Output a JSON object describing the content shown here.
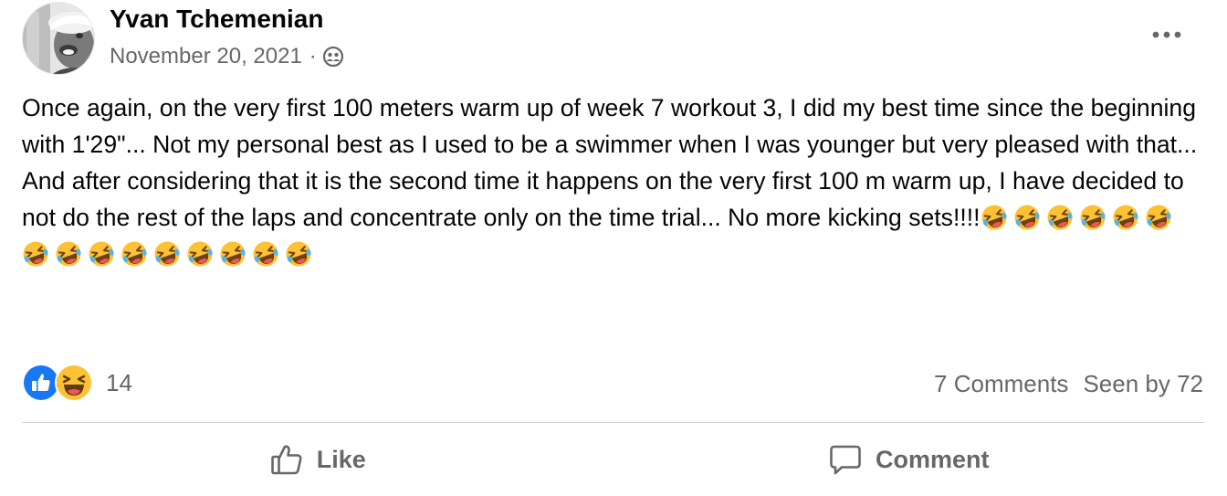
{
  "post": {
    "author": "Yvan Tchemenian",
    "date": "November 20, 2021",
    "separator": "·",
    "audience_icon": "group-icon",
    "more_icon": "more-options-icon",
    "text": "Once again, on the very first 100 meters warm up of week 7 workout 3, I did my best time since the beginning with 1'29\"... Not my personal best as I used to be a swimmer when I was younger but very pleased with that... And after considering that it is the second time it happens on the very first 100 m warm up, I have decided to not do the rest of the laps and concentrate only on the time trial... No more kicking sets!!!!",
    "emoji": "rolling-on-the-floor-laughing",
    "emoji_count": 15
  },
  "reactions": {
    "types": [
      "like",
      "haha"
    ],
    "count": "14"
  },
  "stats": {
    "comments": "7 Comments",
    "seen_by": "Seen by 72"
  },
  "actions": {
    "like_label": "Like",
    "comment_label": "Comment"
  },
  "colors": {
    "text": "#050505",
    "secondary": "#65676b",
    "divider": "#ced0d4",
    "like_blue": "#1877f2",
    "emoji_yellow": "#fcc233"
  }
}
